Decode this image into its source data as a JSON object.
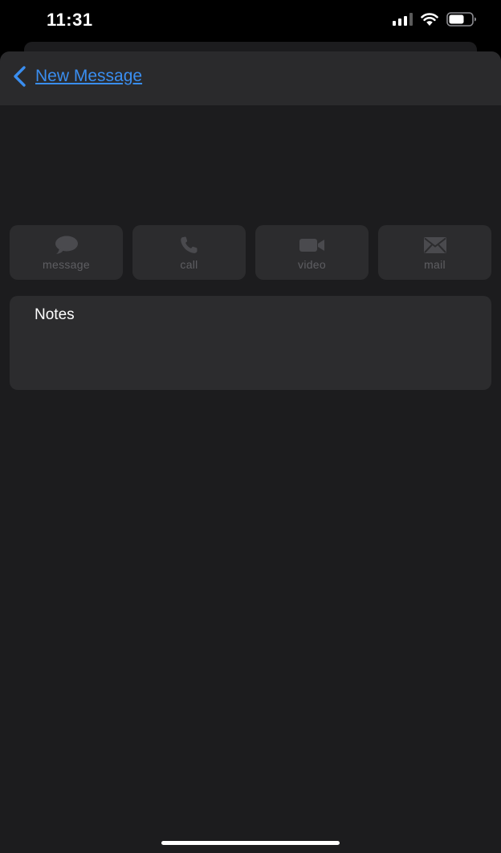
{
  "status_bar": {
    "time": "11:31",
    "icons": [
      "cellular-signal-icon",
      "wifi-icon",
      "battery-icon"
    ]
  },
  "nav": {
    "back_label": "New Message",
    "back_icon": "chevron-left-icon"
  },
  "actions": [
    {
      "label": "message",
      "icon": "message-bubble-icon"
    },
    {
      "label": "call",
      "icon": "phone-icon"
    },
    {
      "label": "video",
      "icon": "video-camera-icon"
    },
    {
      "label": "mail",
      "icon": "envelope-icon"
    }
  ],
  "notes": {
    "label": "Notes"
  },
  "colors": {
    "background": "#1c1c1e",
    "nav_background": "#2a2a2c",
    "card": "#2c2c2e",
    "accent": "#3a8ef0",
    "disabled_text": "#5e5e62"
  }
}
